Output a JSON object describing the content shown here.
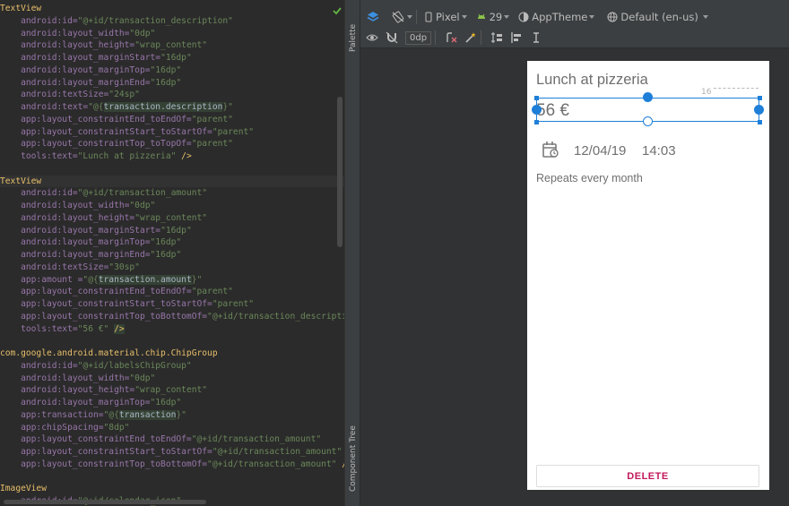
{
  "editor": {
    "lines": [
      {
        "t": "tag",
        "parts": [
          {
            "c": "tag",
            "s": "TextView"
          }
        ]
      },
      {
        "parts": [
          {
            "c": "attr",
            "s": "    android:id="
          },
          {
            "c": "val",
            "s": "\"@+id/transaction_description\""
          }
        ]
      },
      {
        "parts": [
          {
            "c": "attr",
            "s": "    android:layout_width="
          },
          {
            "c": "val",
            "s": "\"0dp\""
          }
        ]
      },
      {
        "parts": [
          {
            "c": "attr",
            "s": "    android:layout_height="
          },
          {
            "c": "val",
            "s": "\"wrap_content\""
          }
        ]
      },
      {
        "parts": [
          {
            "c": "attr",
            "s": "    android:layout_marginStart="
          },
          {
            "c": "val",
            "s": "\"16dp\""
          }
        ]
      },
      {
        "parts": [
          {
            "c": "attr",
            "s": "    android:layout_marginTop="
          },
          {
            "c": "val",
            "s": "\"16dp\""
          }
        ]
      },
      {
        "parts": [
          {
            "c": "attr",
            "s": "    android:layout_marginEnd="
          },
          {
            "c": "val",
            "s": "\"16dp\""
          }
        ]
      },
      {
        "parts": [
          {
            "c": "attr",
            "s": "    android:textSize="
          },
          {
            "c": "val",
            "s": "\"24sp\""
          }
        ]
      },
      {
        "parts": [
          {
            "c": "attr",
            "s": "    android:text="
          },
          {
            "c": "val",
            "s": "\"@{"
          },
          {
            "c": "hl",
            "s": "transaction.description"
          },
          {
            "c": "val",
            "s": "}\""
          }
        ]
      },
      {
        "parts": [
          {
            "c": "attr",
            "s": "    app:layout_constraintEnd_toEndOf="
          },
          {
            "c": "val",
            "s": "\"parent\""
          }
        ]
      },
      {
        "parts": [
          {
            "c": "attr",
            "s": "    app:layout_constraintStart_toStartOf="
          },
          {
            "c": "val",
            "s": "\"parent\""
          }
        ]
      },
      {
        "parts": [
          {
            "c": "attr",
            "s": "    app:layout_constraintTop_toTopOf="
          },
          {
            "c": "val",
            "s": "\"parent\""
          }
        ]
      },
      {
        "parts": [
          {
            "c": "attr",
            "s": "    tools:text="
          },
          {
            "c": "val",
            "s": "\"Lunch at pizzeria\""
          },
          {
            "c": "tag",
            "s": " />"
          }
        ]
      },
      {
        "parts": [
          {
            "c": "plain",
            "s": ""
          }
        ]
      },
      {
        "current": true,
        "parts": [
          {
            "c": "tag",
            "s": "TextView"
          }
        ]
      },
      {
        "parts": [
          {
            "c": "attr",
            "s": "    android:id="
          },
          {
            "c": "val",
            "s": "\"@+id/transaction_amount\""
          }
        ]
      },
      {
        "parts": [
          {
            "c": "attr",
            "s": "    android:layout_width="
          },
          {
            "c": "val",
            "s": "\"0dp\""
          }
        ]
      },
      {
        "parts": [
          {
            "c": "attr",
            "s": "    android:layout_height="
          },
          {
            "c": "val",
            "s": "\"wrap_content\""
          }
        ]
      },
      {
        "parts": [
          {
            "c": "attr",
            "s": "    android:layout_marginStart="
          },
          {
            "c": "val",
            "s": "\"16dp\""
          }
        ]
      },
      {
        "parts": [
          {
            "c": "attr",
            "s": "    android:layout_marginTop="
          },
          {
            "c": "val",
            "s": "\"16dp\""
          }
        ]
      },
      {
        "parts": [
          {
            "c": "attr",
            "s": "    android:layout_marginEnd="
          },
          {
            "c": "val",
            "s": "\"16dp\""
          }
        ]
      },
      {
        "parts": [
          {
            "c": "attr",
            "s": "    android:textSize="
          },
          {
            "c": "val",
            "s": "\"30sp\""
          }
        ]
      },
      {
        "parts": [
          {
            "c": "attr",
            "s": "    app:amount ="
          },
          {
            "c": "val",
            "s": "\"@{"
          },
          {
            "c": "hl",
            "s": "transaction.amount"
          },
          {
            "c": "val",
            "s": "}\""
          }
        ]
      },
      {
        "parts": [
          {
            "c": "attr",
            "s": "    app:layout_constraintEnd_toEndOf="
          },
          {
            "c": "val",
            "s": "\"parent\""
          }
        ]
      },
      {
        "parts": [
          {
            "c": "attr",
            "s": "    app:layout_constraintStart_toStartOf="
          },
          {
            "c": "val",
            "s": "\"parent\""
          }
        ]
      },
      {
        "parts": [
          {
            "c": "attr",
            "s": "    app:layout_constraintTop_toBottomOf="
          },
          {
            "c": "val",
            "s": "\"@+id/transaction_description\""
          }
        ]
      },
      {
        "parts": [
          {
            "c": "attr",
            "s": "    tools:text="
          },
          {
            "c": "val",
            "s": "\"56 €\" "
          },
          {
            "c": "hlend",
            "s": "/>"
          }
        ]
      },
      {
        "parts": [
          {
            "c": "plain",
            "s": ""
          }
        ]
      },
      {
        "parts": [
          {
            "c": "tag",
            "s": "com.google.android.material.chip.ChipGroup"
          }
        ]
      },
      {
        "parts": [
          {
            "c": "attr",
            "s": "    android:id="
          },
          {
            "c": "val",
            "s": "\"@+id/labelsChipGroup\""
          }
        ]
      },
      {
        "parts": [
          {
            "c": "attr",
            "s": "    android:layout_width="
          },
          {
            "c": "val",
            "s": "\"0dp\""
          }
        ]
      },
      {
        "parts": [
          {
            "c": "attr",
            "s": "    android:layout_height="
          },
          {
            "c": "val",
            "s": "\"wrap_content\""
          }
        ]
      },
      {
        "parts": [
          {
            "c": "attr",
            "s": "    android:layout_marginTop="
          },
          {
            "c": "val",
            "s": "\"16dp\""
          }
        ]
      },
      {
        "parts": [
          {
            "c": "attr",
            "s": "    app:transaction="
          },
          {
            "c": "val",
            "s": "\"@{"
          },
          {
            "c": "hl",
            "s": "transaction"
          },
          {
            "c": "val",
            "s": "}\""
          }
        ]
      },
      {
        "parts": [
          {
            "c": "attr",
            "s": "    app:chipSpacing="
          },
          {
            "c": "val",
            "s": "\"8dp\""
          }
        ]
      },
      {
        "parts": [
          {
            "c": "attr",
            "s": "    app:layout_constraintEnd_toEndOf="
          },
          {
            "c": "val",
            "s": "\"@+id/transaction_amount\""
          }
        ]
      },
      {
        "parts": [
          {
            "c": "attr",
            "s": "    app:layout_constraintStart_toStartOf="
          },
          {
            "c": "val",
            "s": "\"@+id/transaction_amount\""
          }
        ]
      },
      {
        "parts": [
          {
            "c": "attr",
            "s": "    app:layout_constraintTop_toBottomOf="
          },
          {
            "c": "val",
            "s": "\"@+id/transaction_amount\""
          },
          {
            "c": "tag",
            "s": " />"
          }
        ]
      },
      {
        "parts": [
          {
            "c": "plain",
            "s": ""
          }
        ]
      },
      {
        "parts": [
          {
            "c": "tag",
            "s": "ImageView"
          }
        ]
      },
      {
        "parts": [
          {
            "c": "attr",
            "s": "    android:id="
          },
          {
            "c": "val",
            "s": "\"@+id/calendar_icon\""
          }
        ]
      }
    ]
  },
  "side_panel": {
    "palette_label": "Palette",
    "component_tree_label": "Component Tree"
  },
  "toolbar": {
    "device": "Pixel",
    "api_level": "29",
    "theme": "AppTheme",
    "locale": "Default (en-us)",
    "default_margin": "0dp"
  },
  "preview": {
    "description": "Lunch at pizzeria",
    "amount": "56 €",
    "margin_indicator": "16",
    "date": "12/04/19",
    "time": "14:03",
    "repeat": "Repeats every month",
    "delete_label": "DELETE"
  },
  "colors": {
    "accent": "#1e7fd9",
    "delete_text": "#c2185b"
  }
}
